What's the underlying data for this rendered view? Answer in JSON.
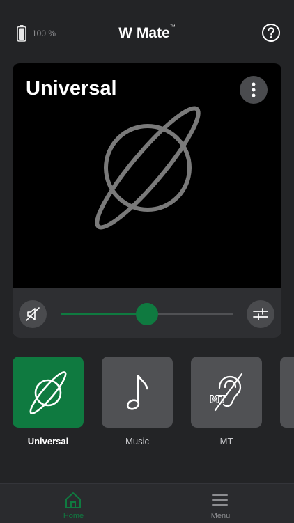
{
  "status": {
    "battery_label": "100 %",
    "battery_level": 1.0
  },
  "header": {
    "title": "W Mate",
    "trademark": "™",
    "help_icon": "help-circle-icon"
  },
  "card": {
    "title": "Universal",
    "hero_icon": "planet-icon",
    "more_icon": "more-vertical-icon",
    "volume": {
      "muted_icon": "speaker-muted-icon",
      "level": 0.5,
      "equalizer_icon": "sliders-icon"
    }
  },
  "programs": [
    {
      "label": "Universal",
      "icon": "planet-icon",
      "active": true
    },
    {
      "label": "Music",
      "icon": "music-note-icon",
      "active": false
    },
    {
      "label": "MT",
      "icon": "hearing-loop-mt-icon",
      "active": false
    },
    {
      "label": "",
      "icon": "",
      "active": false
    }
  ],
  "tabs": [
    {
      "label": "Home",
      "icon": "home-icon",
      "active": true
    },
    {
      "label": "Menu",
      "icon": "hamburger-menu-icon",
      "active": false
    }
  ],
  "colors": {
    "accent": "#0f7a40",
    "background": "#232426",
    "tile": "#505154",
    "card": "#000000"
  }
}
